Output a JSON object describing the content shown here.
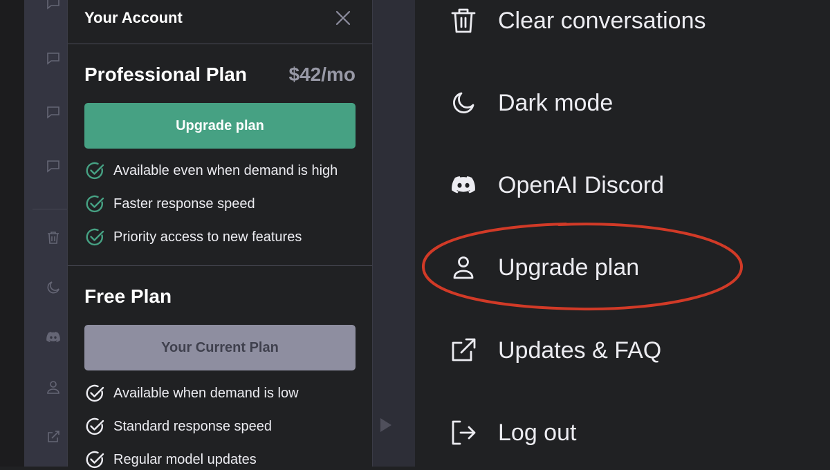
{
  "modal": {
    "title": "Your Account",
    "professional": {
      "name": "Professional Plan",
      "price": "$42/mo",
      "button_label": "Upgrade plan",
      "features": [
        "Available even when demand is high",
        "Faster response speed",
        "Priority access to new features"
      ]
    },
    "free": {
      "name": "Free Plan",
      "button_label": "Your Current Plan",
      "features": [
        "Available when demand is low",
        "Standard response speed",
        "Regular model updates"
      ]
    }
  },
  "menu": {
    "items": [
      {
        "label": "Clear conversations",
        "icon": "trash-icon"
      },
      {
        "label": "Dark mode",
        "icon": "moon-icon"
      },
      {
        "label": "OpenAI Discord",
        "icon": "discord-icon"
      },
      {
        "label": "Upgrade plan",
        "icon": "user-icon"
      },
      {
        "label": "Updates & FAQ",
        "icon": "external-link-icon"
      },
      {
        "label": "Log out",
        "icon": "logout-icon"
      }
    ]
  },
  "colors": {
    "upgrade_button": "#46a183",
    "current_plan_button": "#8e8ea0",
    "check_pro": "#46a183",
    "check_free": "#ececf1",
    "annotation": "#d13a27",
    "background": "#202123"
  }
}
